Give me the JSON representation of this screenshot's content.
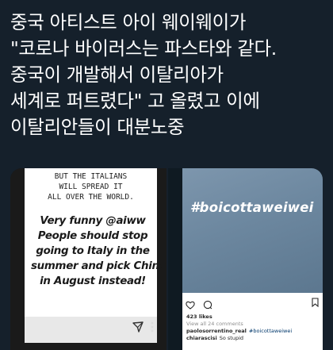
{
  "headline": {
    "lines": [
      "중국 아티스트 아이 웨이웨이가",
      "\"코로나 바이러스는 파스타와 같다.",
      "중국이 개발해서 이탈리아가",
      "세계로 퍼트렸다\" 고 올렸고 이에",
      "이탈리안들이 대분노중"
    ]
  },
  "left_image": {
    "top_lines": [
      "BUT THE ITALIANS",
      "WILL SPREAD IT",
      "ALL OVER THE WORLD."
    ],
    "body_lines": [
      "Very funny @aiww",
      "People should stop",
      "going to Italy in the",
      "summer and pick China",
      "in August instead!"
    ]
  },
  "right_image": {
    "hashtag": "#boicottaweiwei",
    "likes": "423 likes",
    "view_all": "View all 24 comments",
    "comment1_user": "paolosorrentino_real",
    "comment1_text": "#boicottaweiwei",
    "comment2_user": "chiarascisi",
    "comment2_text": "So stupid"
  },
  "colors": {
    "background": "#15202b",
    "text": "#ffffff",
    "photo": "#6c879f"
  }
}
